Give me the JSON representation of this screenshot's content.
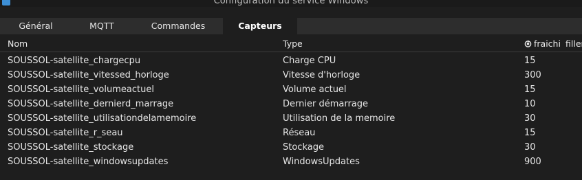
{
  "window": {
    "title": "Configuration du service Windows"
  },
  "tabs": [
    {
      "label": "Général"
    },
    {
      "label": "MQTT"
    },
    {
      "label": "Commandes"
    },
    {
      "label": "Capteurs",
      "active": true
    }
  ],
  "table": {
    "columns": {
      "nom": "Nom",
      "type": "Type",
      "refresh_icon": "refresh-icon",
      "refresh": "fraichi",
      "filler": "filler"
    },
    "rows": [
      {
        "nom": "SOUSSOL-satellite_chargecpu",
        "type": "Charge CPU",
        "refresh": "15"
      },
      {
        "nom": "SOUSSOL-satellite_vitessed_horloge",
        "type": "Vitesse d'horloge",
        "refresh": "300"
      },
      {
        "nom": "SOUSSOL-satellite_volumeactuel",
        "type": "Volume actuel",
        "refresh": "15"
      },
      {
        "nom": "SOUSSOL-satellite_dernierd_marrage",
        "type": "Dernier démarrage",
        "refresh": "10"
      },
      {
        "nom": "SOUSSOL-satellite_utilisationdelamemoire",
        "type": "Utilisation de la memoire",
        "refresh": "30"
      },
      {
        "nom": "SOUSSOL-satellite_r_seau",
        "type": "Réseau",
        "refresh": "15"
      },
      {
        "nom": "SOUSSOL-satellite_stockage",
        "type": "Stockage",
        "refresh": "30"
      },
      {
        "nom": "SOUSSOL-satellite_windowsupdates",
        "type": "WindowsUpdates",
        "refresh": "900"
      }
    ]
  },
  "colors": {
    "background": "#1e1e1e",
    "tabbar": "#2d2d2d",
    "text": "#e6e6e6"
  }
}
